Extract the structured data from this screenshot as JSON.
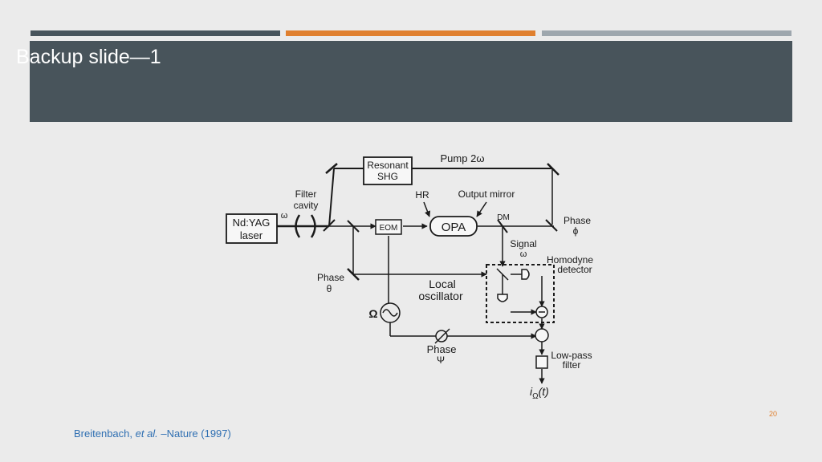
{
  "slide": {
    "title": "Backup slide—1",
    "page_number": "20",
    "citation": {
      "authors": "Breitenbach, ",
      "etal": "et al.",
      "source": " –Nature (1997)"
    }
  },
  "diagram": {
    "labels": {
      "laser_line1": "Nd:YAG",
      "laser_line2": "laser",
      "filter_line1": "Filter",
      "filter_line2": "cavity",
      "omega": "ω",
      "shg_line1": "Resonant",
      "shg_line2": "SHG",
      "pump": "Pump 2ω",
      "hr": "HR",
      "output_mirror": "Output mirror",
      "dm": "DM",
      "eom": "EOM",
      "opa": "OPA",
      "phase_phi_line1": "Phase",
      "phase_phi_line2": "ϕ",
      "signal_line1": "Signal",
      "signal_line2": "ω",
      "homodyne_line1": "Homodyne",
      "homodyne_line2": "detector",
      "phase_theta_line1": "Phase",
      "phase_theta_line2": "θ",
      "lo_line1": "Local",
      "lo_line2": "oscillator",
      "big_omega": "Ω",
      "phase_psi_line1": "Phase",
      "phase_psi_line2": "Ψ",
      "lowpass_line1": "Low-pass",
      "lowpass_line2": "filter",
      "output_i": "i",
      "output_sub": "Ω",
      "output_arg": "(t)"
    }
  }
}
